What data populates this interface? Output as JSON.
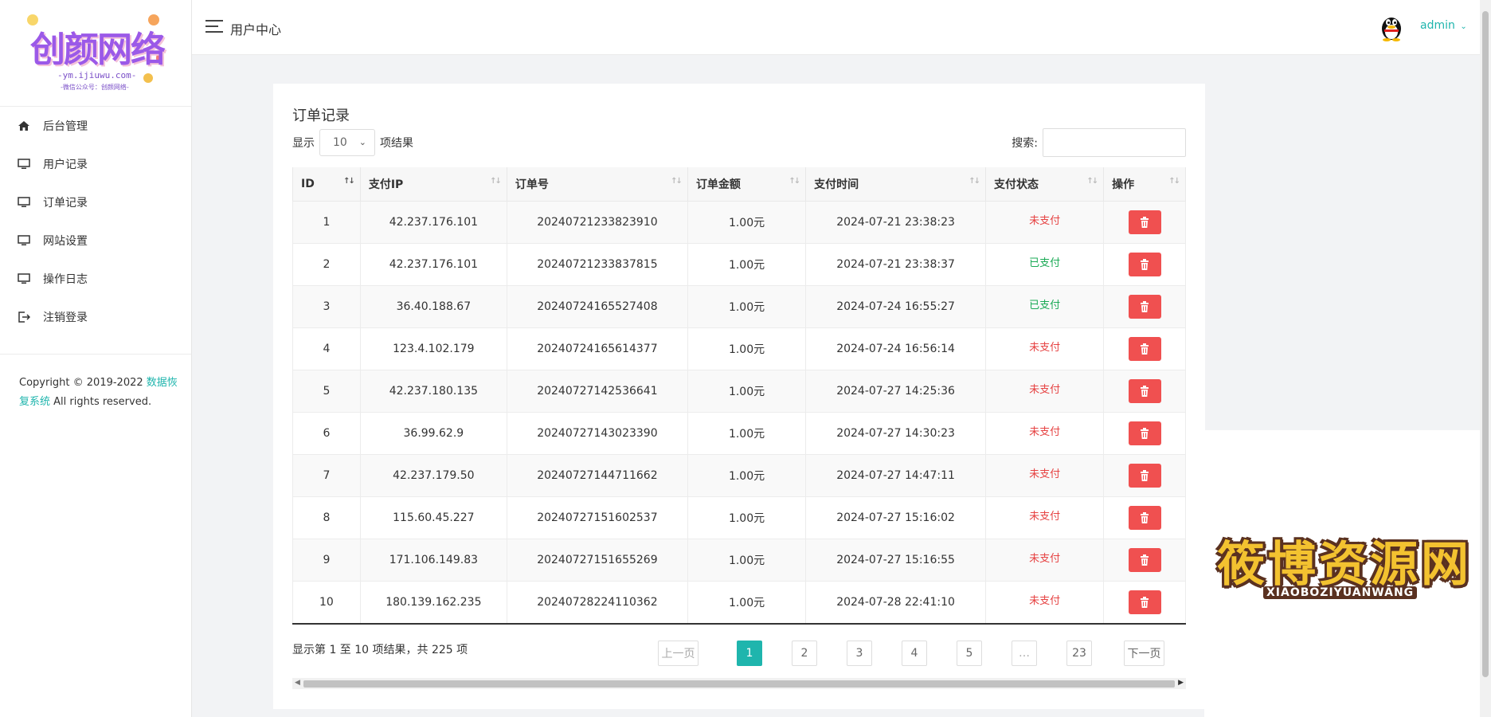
{
  "brand": {
    "logo_text": "创颜网络",
    "logo_url": "-ym.ijiuwu.com-",
    "logo_sub": "-微信公众号：创颜网络-"
  },
  "sidebar": {
    "items": [
      {
        "label": "后台管理",
        "icon": "home-icon"
      },
      {
        "label": "用户记录",
        "icon": "monitor-icon"
      },
      {
        "label": "订单记录",
        "icon": "monitor-icon"
      },
      {
        "label": "网站设置",
        "icon": "monitor-icon"
      },
      {
        "label": "操作日志",
        "icon": "monitor-icon"
      },
      {
        "label": "注销登录",
        "icon": "logout-icon"
      }
    ],
    "copyright_prefix": "Copyright © 2019-2022 ",
    "copyright_link": "数据恢复系统",
    "copyright_suffix": " All rights reserved."
  },
  "header": {
    "title": "用户中心",
    "user": "admin"
  },
  "card": {
    "title": "订单记录",
    "show_label": "显示",
    "page_length": "10",
    "results_label": "项结果",
    "search_label": "搜索:",
    "search_value": ""
  },
  "table": {
    "columns": [
      "ID",
      "支付IP",
      "订单号",
      "订单金额",
      "支付时间",
      "支付状态",
      "操作"
    ],
    "rows": [
      {
        "id": "1",
        "ip": "42.237.176.101",
        "order_no": "20240721233823910",
        "amount": "1.00元",
        "time": "2024-07-21 23:38:23",
        "status": "未支付",
        "paid": false
      },
      {
        "id": "2",
        "ip": "42.237.176.101",
        "order_no": "20240721233837815",
        "amount": "1.00元",
        "time": "2024-07-21 23:38:37",
        "status": "已支付",
        "paid": true
      },
      {
        "id": "3",
        "ip": "36.40.188.67",
        "order_no": "20240724165527408",
        "amount": "1.00元",
        "time": "2024-07-24 16:55:27",
        "status": "已支付",
        "paid": true
      },
      {
        "id": "4",
        "ip": "123.4.102.179",
        "order_no": "20240724165614377",
        "amount": "1.00元",
        "time": "2024-07-24 16:56:14",
        "status": "未支付",
        "paid": false
      },
      {
        "id": "5",
        "ip": "42.237.180.135",
        "order_no": "20240727142536641",
        "amount": "1.00元",
        "time": "2024-07-27 14:25:36",
        "status": "未支付",
        "paid": false
      },
      {
        "id": "6",
        "ip": "36.99.62.9",
        "order_no": "20240727143023390",
        "amount": "1.00元",
        "time": "2024-07-27 14:30:23",
        "status": "未支付",
        "paid": false
      },
      {
        "id": "7",
        "ip": "42.237.179.50",
        "order_no": "20240727144711662",
        "amount": "1.00元",
        "time": "2024-07-27 14:47:11",
        "status": "未支付",
        "paid": false
      },
      {
        "id": "8",
        "ip": "115.60.45.227",
        "order_no": "20240727151602537",
        "amount": "1.00元",
        "time": "2024-07-27 15:16:02",
        "status": "未支付",
        "paid": false
      },
      {
        "id": "9",
        "ip": "171.106.149.83",
        "order_no": "20240727151655269",
        "amount": "1.00元",
        "time": "2024-07-27 15:16:55",
        "status": "未支付",
        "paid": false
      },
      {
        "id": "10",
        "ip": "180.139.162.235",
        "order_no": "20240728224110362",
        "amount": "1.00元",
        "time": "2024-07-28 22:41:10",
        "status": "未支付",
        "paid": false
      }
    ],
    "delete_icon": "trash-icon"
  },
  "footer": {
    "info": "显示第 1 至 10 项结果，共 225 项",
    "prev": "上一页",
    "next": "下一页",
    "pages": [
      "1",
      "2",
      "3",
      "4",
      "5",
      "…",
      "23"
    ],
    "current_page": "1"
  },
  "watermark": {
    "text": "筱博资源网",
    "sub": "XIAOBOZIYUANWANG"
  },
  "colors": {
    "accent": "#1fb5ad",
    "danger": "#f05050",
    "unpaid": "#e64242",
    "paid": "#1aaa55"
  }
}
